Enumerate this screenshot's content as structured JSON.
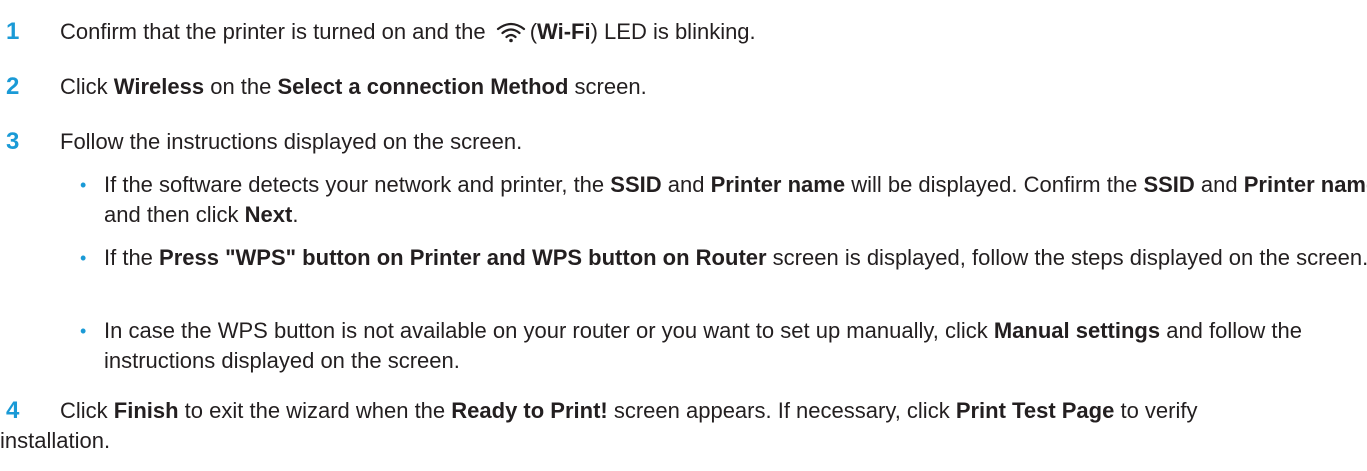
{
  "steps": [
    {
      "num": "1",
      "parts": {
        "a": "Confirm that the printer is turned on and the",
        "b": "(",
        "c": "Wi-Fi",
        "d": ") LED is blinking."
      }
    },
    {
      "num": "2",
      "parts": {
        "a": "Click ",
        "b": "Wireless",
        "c": " on the ",
        "d": "Select a connection Method",
        "e": " screen."
      }
    },
    {
      "num": "3",
      "text": "Follow the instructions displayed on the screen.",
      "bullets": [
        {
          "parts": {
            "a": "If the software detects your network and printer, the ",
            "b": "SSID",
            "c": " and ",
            "d": "Printer name",
            "e": " will be displayed. Confirm the ",
            "f": "SSID",
            "g": " and ",
            "h": "Printer name",
            "i": " and then click ",
            "j": "Next",
            "k": "."
          }
        },
        {
          "parts": {
            "a": "If the ",
            "b": "Press \"WPS\" button on Printer and WPS button on Router",
            "c": " screen is displayed, follow the steps displayed on the screen."
          }
        },
        {
          "parts": {
            "a": "In case the WPS button is not available on your router or you want to set up manually, click ",
            "b": "Manual settings",
            "c": " and follow the instructions displayed on the screen."
          }
        }
      ]
    },
    {
      "num": "4",
      "parts": {
        "a": "Click ",
        "b": "Finish",
        "c": " to exit the wizard when the ",
        "d": "Ready to Print!",
        "e": " screen appears. If necessary, click ",
        "f": "Print Test Page",
        "g": " to verify installation."
      }
    }
  ],
  "bullet_glyph": "•",
  "accent_color": "#1a9ad6",
  "icons": {
    "wifi": "wifi-icon"
  }
}
